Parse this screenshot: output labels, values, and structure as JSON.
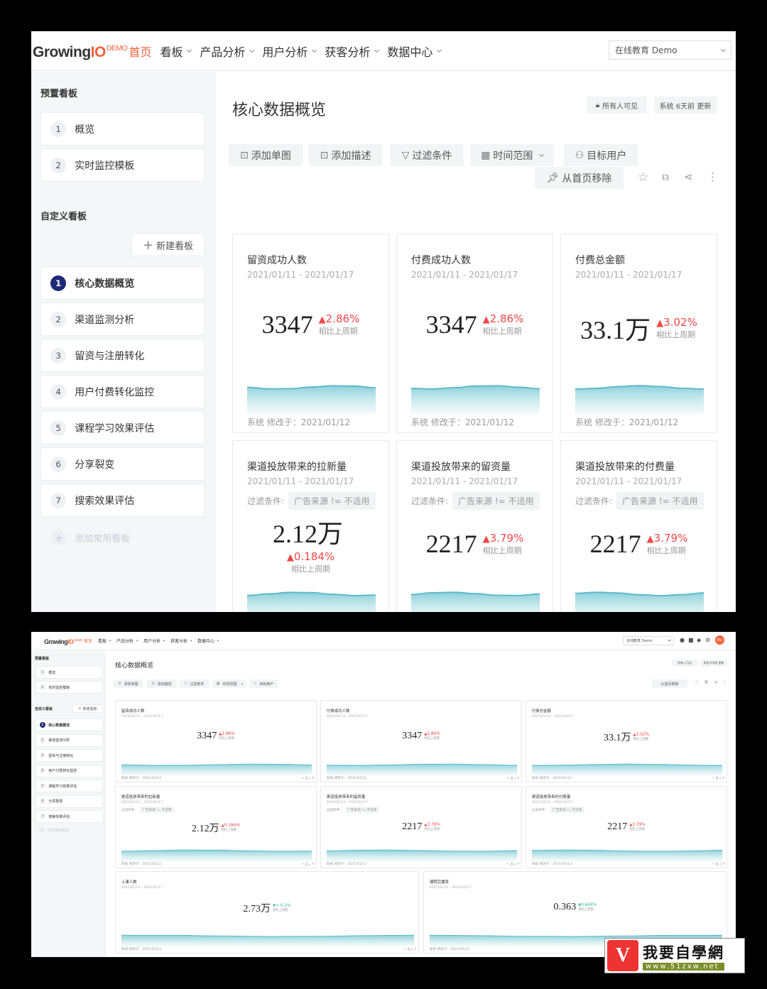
{
  "header": {
    "logo": {
      "growing": "Growing",
      "io": "IO",
      "demo": "DEMO"
    },
    "nav": [
      {
        "label": "首页"
      },
      {
        "label": "看板"
      },
      {
        "label": "产品分析"
      },
      {
        "label": "用户分析"
      },
      {
        "label": "获客分析"
      },
      {
        "label": "数据中心"
      }
    ],
    "project": "在线教育 Demo",
    "avatar": "BU"
  },
  "sidebar": {
    "preset_title": "预置看板",
    "preset_items": [
      {
        "num": "1",
        "label": "概览"
      },
      {
        "num": "2",
        "label": "实时监控模板"
      }
    ],
    "custom_title": "自定义看板",
    "new_board": "新建看板",
    "custom_items": [
      {
        "num": "1",
        "label": "核心数据概览"
      },
      {
        "num": "2",
        "label": "渠道监测分析"
      },
      {
        "num": "3",
        "label": "留资与注册转化"
      },
      {
        "num": "4",
        "label": "用户付费转化监控"
      },
      {
        "num": "5",
        "label": "课程学习效果评估"
      },
      {
        "num": "6",
        "label": "分享裂变"
      },
      {
        "num": "7",
        "label": "搜索效果评估"
      }
    ],
    "add_common": "添加常用看板"
  },
  "main": {
    "title": "核心数据概览",
    "visibility": "所有人可见",
    "updated": "系统 6天前 更新",
    "toolbar": [
      {
        "label": "添加单图",
        "icon": "add-chart-icon"
      },
      {
        "label": "添加描述",
        "icon": "add-text-icon"
      },
      {
        "label": "过滤条件",
        "icon": "filter-icon"
      },
      {
        "label": "时间范围",
        "icon": "calendar-icon"
      },
      {
        "label": "目标用户",
        "icon": "user-icon"
      }
    ],
    "remove_home": "从首页移除"
  },
  "cards": [
    {
      "title": "留资成功人数",
      "date": "2021/01/11 - 2021/01/17",
      "value": "3347",
      "change": "2.86%",
      "dir": "up",
      "compare": "相比上周期",
      "footer": "系统 修改于：2021/01/12",
      "filter": false
    },
    {
      "title": "付费成功人数",
      "date": "2021/01/11 - 2021/01/17",
      "value": "3347",
      "change": "2.86%",
      "dir": "up",
      "compare": "相比上周期",
      "footer": "系统 修改于：2021/01/12",
      "filter": false
    },
    {
      "title": "付费总金额",
      "date": "2021/01/11 - 2021/01/17",
      "value": "33.1万",
      "change": "3.02%",
      "dir": "up",
      "compare": "相比上周期",
      "footer": "系统 修改于：2021/01/12",
      "filter": false
    },
    {
      "title": "渠道投放带来的拉新量",
      "date": "2021/01/11 - 2021/01/17",
      "value": "2.12万",
      "change": "0.184%",
      "dir": "up",
      "compare": "相比上周期",
      "footer": "系统 修改于：2021/01/12",
      "filter": true
    },
    {
      "title": "渠道投放带来的留资量",
      "date": "2021/01/11 - 2021/01/17",
      "value": "2217",
      "change": "3.79%",
      "dir": "up",
      "compare": "相比上周期",
      "footer": "系统 修改于：2021/01/12",
      "filter": true
    },
    {
      "title": "渠道投放带来的付费量",
      "date": "2021/01/11 - 2021/01/17",
      "value": "2217",
      "change": "3.79%",
      "dir": "up",
      "compare": "相比上周期",
      "footer": "系统 修改于：2021/01/12",
      "filter": true
    },
    {
      "title": "上课人数",
      "date": "2021/01/11 - 2021/01/17",
      "value": "2.73万",
      "change": "< 0.1%",
      "dir": "down",
      "compare": "相比上周期",
      "footer": "系统 修改于：2021/01/12",
      "filter": false
    },
    {
      "title": "课程完播率",
      "date": "2021/01/11 - 2021/01/17",
      "value": "0.363",
      "change": "0.644%",
      "dir": "down",
      "compare": "相比上周期",
      "footer": "系统 修改于：2021/01/12",
      "filter": false
    }
  ],
  "filter": {
    "label": "过滤条件:",
    "chip": "广告来源 != 不适用"
  },
  "watermark": {
    "title": "我要自學網",
    "url": "www.51zxw.net"
  },
  "colors": {
    "accent": "#f0623a",
    "up": "#f04848",
    "down": "#2bb89a",
    "spark": "#7fcbd6",
    "active_num": "#1e2a78"
  }
}
